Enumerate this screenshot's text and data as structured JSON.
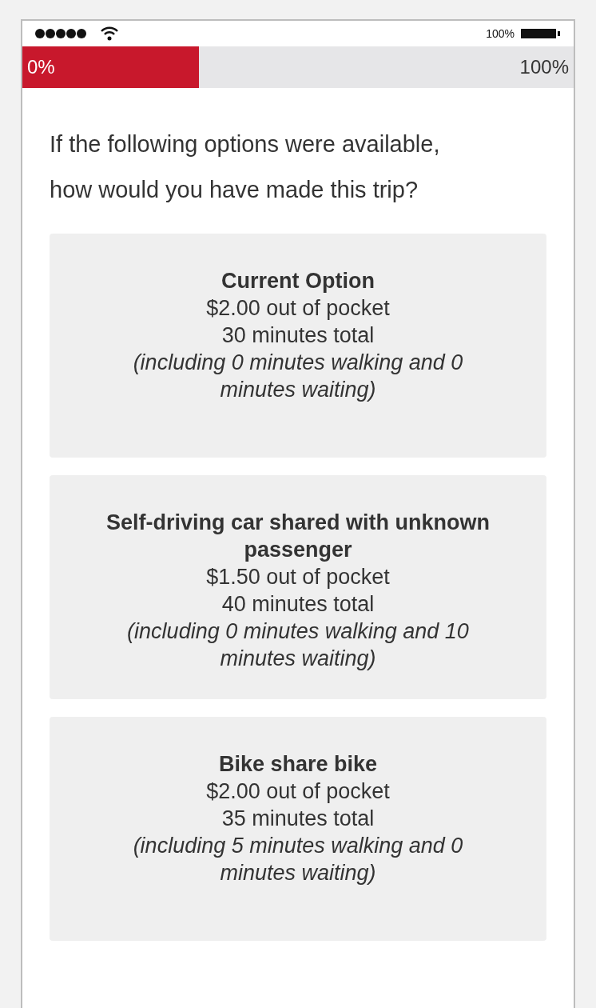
{
  "status_bar": {
    "battery_text": "100%"
  },
  "progress": {
    "level": 0.32,
    "start_label": "0%",
    "end_label": "100%"
  },
  "question": "If the following options were available, how would you have made this trip?",
  "options": [
    {
      "title": "Current Option",
      "cost": "$2.00 out of pocket",
      "time": "30 minutes total",
      "detail": "(including 0 minutes walking and 0 minutes waiting)"
    },
    {
      "title": "Self-driving car shared with unknown passenger",
      "cost": "$1.50 out of pocket",
      "time": "40 minutes total",
      "detail": "(including 0 minutes walking and 10 minutes waiting)"
    },
    {
      "title": "Bike share bike",
      "cost": "$2.00 out of pocket",
      "time": "35 minutes total",
      "detail": "(including 5 minutes walking and 0 minutes waiting)"
    }
  ]
}
